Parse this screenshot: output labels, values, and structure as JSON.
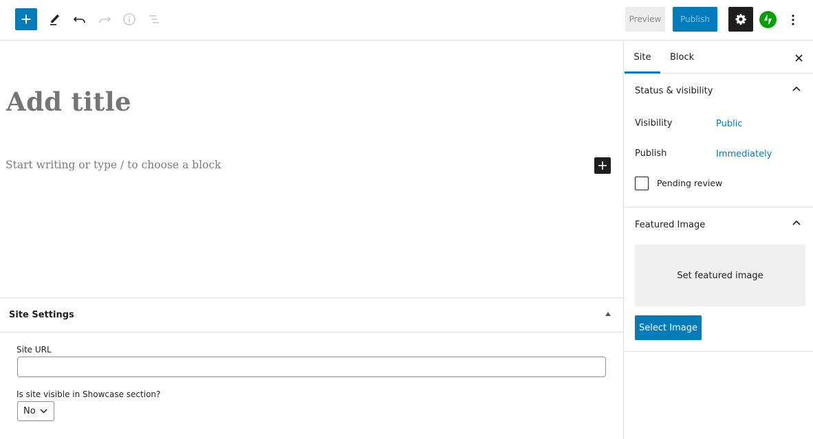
{
  "toolbar": {
    "inserter_icon": "plus-icon",
    "tools": [
      {
        "name": "edit-tool",
        "icon": "pencil-icon"
      },
      {
        "name": "undo",
        "icon": "undo-icon"
      },
      {
        "name": "redo",
        "icon": "redo-icon"
      },
      {
        "name": "details",
        "icon": "info-icon"
      },
      {
        "name": "outline",
        "icon": "list-view-icon"
      }
    ],
    "preview_label": "Preview",
    "publish_label": "Publish",
    "settings_icon": "gear-icon",
    "jetpack_icon": "jetpack-bolt-icon",
    "more_icon": "more-vertical-icon",
    "colors": {
      "accent": "#007cba",
      "dark": "#1e1e1e",
      "jetpack": "#069e08"
    }
  },
  "editor": {
    "title_placeholder": "Add title",
    "body_placeholder": "Start writing or type / to choose a block"
  },
  "meta_box": {
    "title": "Site Settings",
    "site_url_label": "Site URL",
    "site_url_value": "",
    "showcase_label": "Is site visible in Showcase section?",
    "showcase_value": "No"
  },
  "sidebar": {
    "tabs": [
      {
        "label": "Site",
        "active": true
      },
      {
        "label": "Block",
        "active": false
      }
    ],
    "status_panel": {
      "title": "Status & visibility",
      "visibility_label": "Visibility",
      "visibility_value": "Public",
      "publish_label": "Publish",
      "publish_value": "Immediately",
      "pending_review_label": "Pending review",
      "pending_review_checked": false
    },
    "featured_panel": {
      "title": "Featured Image",
      "drop_label": "Set featured image",
      "button_label": "Select Image"
    }
  }
}
